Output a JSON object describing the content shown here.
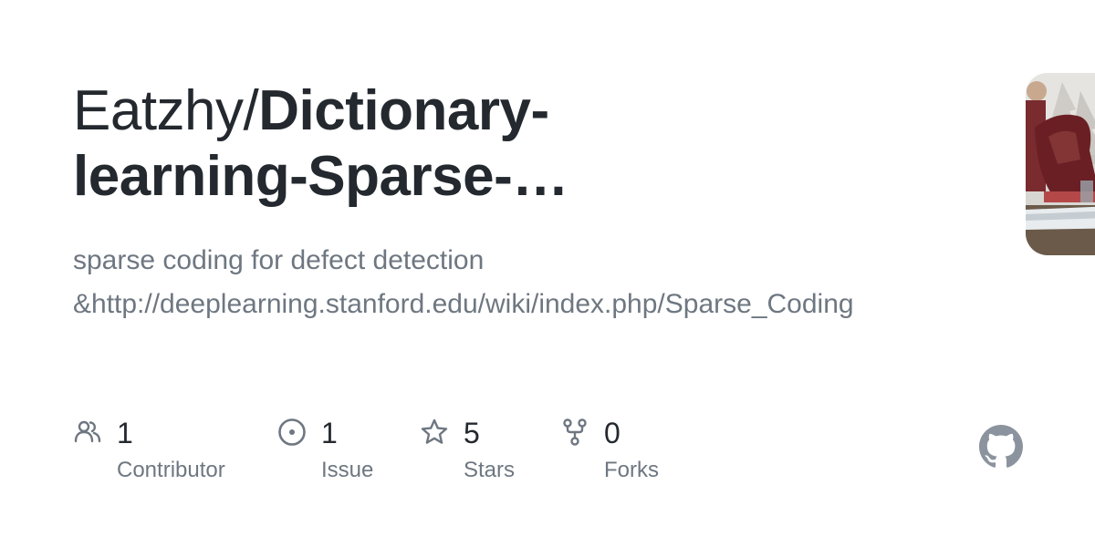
{
  "repo": {
    "owner_prefix": "Eatzhy/",
    "name_display": "Dictionary-learning-Sparse-…",
    "description_line1": "sparse coding for defect detection",
    "description_line2": "&http://deeplearning.stanford.edu/wiki/index.php/Sparse_Coding"
  },
  "stats": {
    "contributors": {
      "count": "1",
      "label": "Contributor",
      "icon": "people-icon"
    },
    "issues": {
      "count": "1",
      "label": "Issue",
      "icon": "issue-opened-icon"
    },
    "stars": {
      "count": "5",
      "label": "Stars",
      "icon": "star-icon"
    },
    "forks": {
      "count": "0",
      "label": "Forks",
      "icon": "repo-forked-icon"
    }
  },
  "branding": {
    "logo": "github-mark-icon",
    "logo_color": "#8b949e"
  },
  "colors": {
    "text_primary": "#24292f",
    "text_secondary": "#6e7781"
  }
}
